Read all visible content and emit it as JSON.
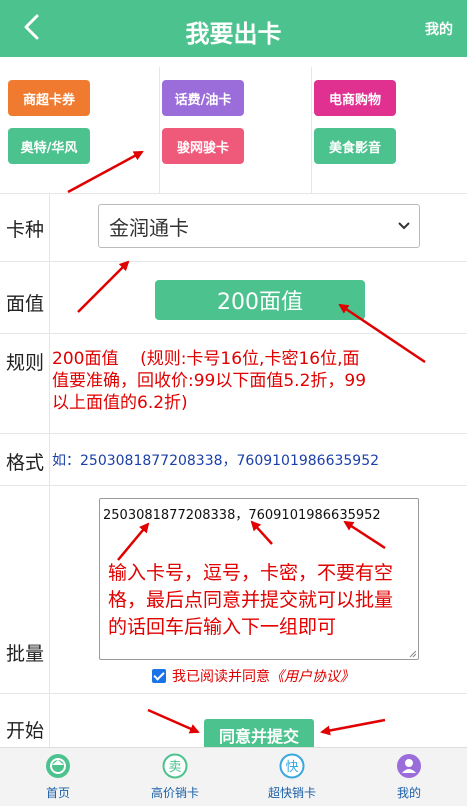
{
  "header": {
    "title": "我要出卡",
    "right_label": "我的",
    "back_icon": "chevron-left-icon"
  },
  "categories": [
    {
      "label": "商超卡券",
      "color": "#f07b30"
    },
    {
      "label": "奥特/华风",
      "color": "#4cc28e"
    },
    {
      "label": "话费/油卡",
      "color": "#9b6ddb"
    },
    {
      "label": "骏网骏卡",
      "color": "#f05a7a"
    },
    {
      "label": "电商购物",
      "color": "#e03090"
    },
    {
      "label": "美食影音",
      "color": "#4cc28e"
    }
  ],
  "form": {
    "card_type": {
      "label": "卡种",
      "selected": "金润通卡"
    },
    "face_value": {
      "label": "面值",
      "button": "200面值"
    },
    "rules": {
      "label": "规则",
      "text": "200面值    (规则:卡号16位,卡密16位,面值要准确，回收价:99以下面值5.2折，99以上面值的6.2折)"
    },
    "format": {
      "label": "格式",
      "text": "如：2503081877208338，7609101986635952"
    },
    "batch": {
      "label": "批量",
      "textarea_value": "2503081877208338，7609101986635952",
      "annotation": "输入卡号，逗号，卡密，不要有空格，最后点同意并提交就可以批量的话回车后输入下一组即可",
      "agree_text": "我已阅读并同意",
      "agree_link": "《用户协议》"
    },
    "start": {
      "label": "开始",
      "submit": "同意并提交"
    }
  },
  "tabbar": [
    {
      "label": "首页",
      "icon": "home-icon",
      "icon_color": "#4cc28e"
    },
    {
      "label": "高价销卡",
      "icon": "sell-icon",
      "icon_color": "#4cc28e"
    },
    {
      "label": "超快销卡",
      "icon": "fast-icon",
      "icon_color": "#3aa7e0"
    },
    {
      "label": "我的",
      "icon": "user-icon",
      "icon_color": "#9b6ddb"
    }
  ],
  "colors": {
    "accent": "#4cc28e",
    "annotation_red": "#e00000"
  }
}
